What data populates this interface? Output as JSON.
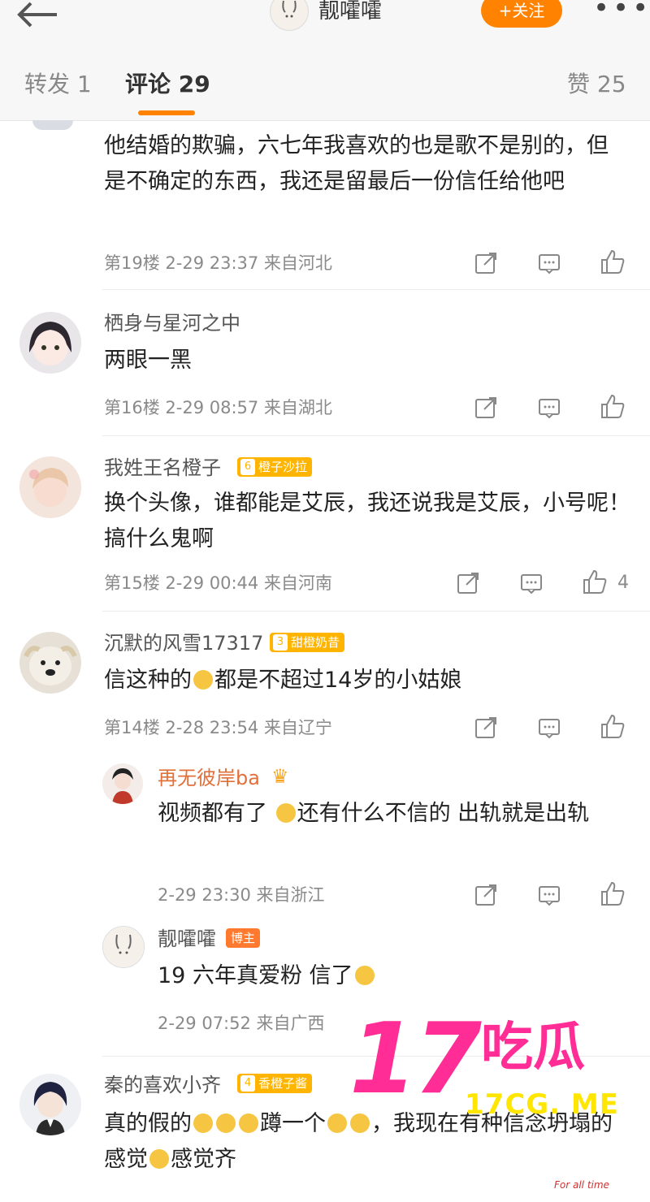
{
  "header": {
    "title": "靓嚯嚯",
    "follow_label": "+关注"
  },
  "tabs": {
    "repost": "转发 1",
    "comments": "评论 29",
    "likes": "赞 25"
  },
  "comments": [
    {
      "text": "他结婚的欺骗，六七年我喜欢的也是歌不是别的，但是不确定的东西，我还是留最后一份信任给他吧",
      "meta": "第19楼 2-29 23:37 来自河北"
    },
    {
      "name": "栖身与星河之中",
      "text": "两眼一黑",
      "meta": "第16楼 2-29 08:57 来自湖北"
    },
    {
      "name": "我姓王名橙子",
      "badge_level": "6",
      "badge": "橙子沙拉",
      "text": "换个头像，谁都能是艾辰，我还说我是艾辰，小号呢！搞什么鬼啊",
      "meta": "第15楼 2-29 00:44 来自河南",
      "likes": "4"
    },
    {
      "name": "沉默的风雪17317",
      "badge_level": "3",
      "badge": "甜橙奶昔",
      "text_pre": "信这种的",
      "text_post": "都是不超过14岁的小姑娘",
      "meta": "第14楼 2-28 23:54 来自辽宁",
      "replies": [
        {
          "name": "再无彼岸ba",
          "text_pre": "视频都有了",
          "text_post": "还有什么不信的 出轨就是出轨",
          "meta": "2-29 23:30 来自浙江"
        },
        {
          "name": "靓嚯嚯",
          "badge": "博主",
          "text": "19 六年真爱粉 信了",
          "meta": "2-29 07:52 来自广西"
        }
      ]
    },
    {
      "name": "秦的喜欢小齐",
      "badge_level": "4",
      "badge": "香橙子酱",
      "text": "真的假的",
      "text_2": "蹲一个",
      "text_3": "我现在有种信念坍塌的感觉",
      "text_4": "感觉齐"
    }
  ],
  "watermark": {
    "big": "17",
    "cn": "吃瓜",
    "url": "17CG. ME",
    "tag": "For all time"
  },
  "colors": {
    "accent": "#ff8200",
    "watermark_pink": "#ff2d95",
    "watermark_yellow": "#ffe600"
  }
}
